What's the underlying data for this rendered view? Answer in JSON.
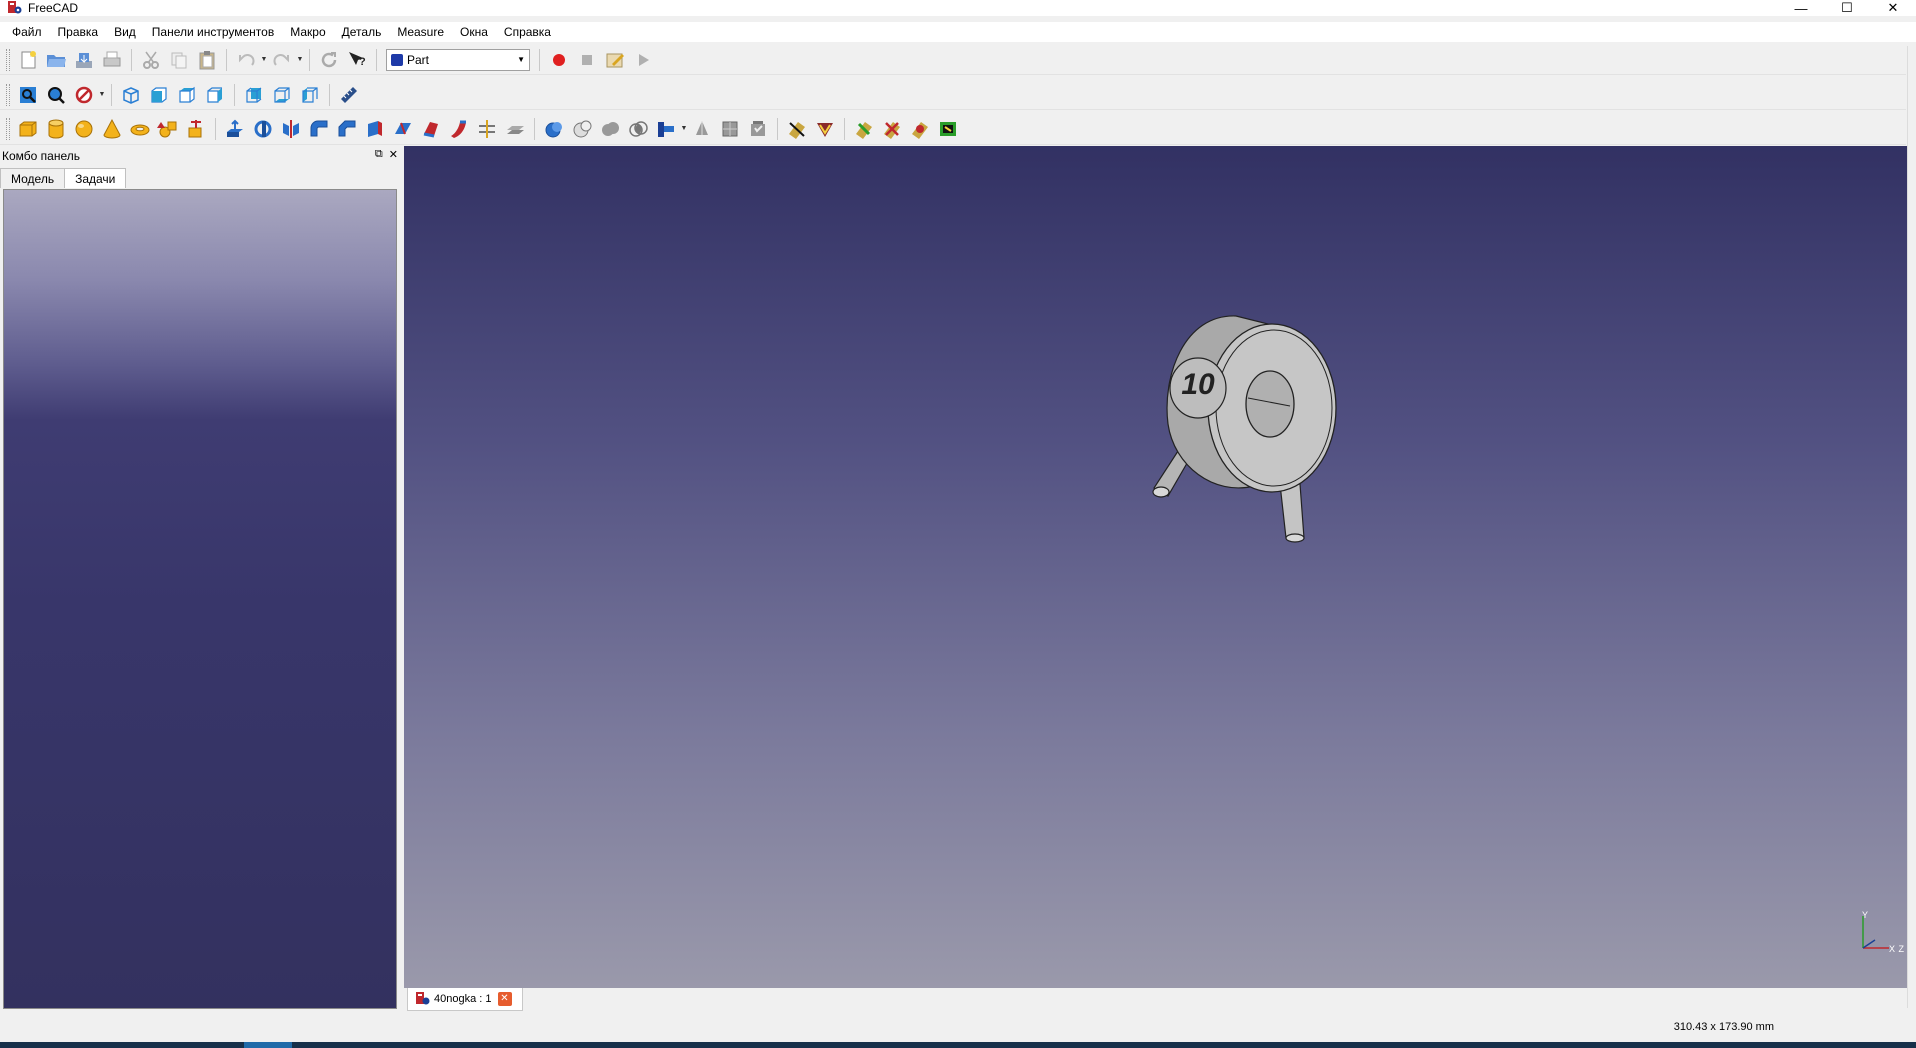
{
  "window": {
    "title": "FreeCAD",
    "controls": [
      "—",
      "☐",
      "✕"
    ]
  },
  "menu": [
    "Файл",
    "Правка",
    "Вид",
    "Панели инструментов",
    "Макро",
    "Деталь",
    "Measure",
    "Окна",
    "Справка"
  ],
  "toolbar": {
    "workbench_value": "Part"
  },
  "combo": {
    "title": "Комбо панель",
    "tabs": [
      "Модель",
      "Задачи"
    ],
    "active_tab": "Задачи"
  },
  "model": {
    "engraving": "10"
  },
  "axis": {
    "y": "Y",
    "x": "X",
    "z": "Z"
  },
  "document_tab": {
    "label": "40nogka : 1"
  },
  "status": {
    "dimensions": "310.43 x 173.90 mm"
  },
  "colors": {
    "view_top": "#323163",
    "view_bottom": "#9a99ab",
    "accent_record": "#e02020",
    "close_tab": "#e65c2e"
  },
  "icons": {
    "toolbar1": [
      "new-file-icon",
      "open-icon",
      "save-icon",
      "print-icon",
      "cut-icon",
      "copy-icon",
      "paste-icon",
      "undo-icon",
      "redo-icon",
      "refresh-icon",
      "whats-this-icon",
      "workbench-selector",
      "macro-record-icon",
      "macro-stop-icon",
      "macro-edit-icon",
      "macro-run-icon"
    ],
    "toolbar2": [
      "fit-all-icon",
      "fit-selection-icon",
      "draw-style-icon",
      "view-isometric-icon",
      "view-front-icon",
      "view-top-icon",
      "view-right-icon",
      "view-rear-icon",
      "view-bottom-icon",
      "view-left-icon",
      "measure-icon"
    ],
    "toolbar3": [
      "box-icon",
      "cylinder-icon",
      "sphere-icon",
      "cone-icon",
      "torus-icon",
      "primitives-icon",
      "shape-builder-icon",
      "extrude-icon",
      "revolve-icon",
      "mirror-icon",
      "fillet-icon",
      "chamfer-icon",
      "make-face-icon",
      "ruled-surface-icon",
      "loft-icon",
      "sweep-icon",
      "section-icon",
      "cross-sections-icon",
      "boolean-icon",
      "cut-icon",
      "fuse-icon",
      "common-icon",
      "join-features-icon",
      "split-features-icon",
      "compound-tools-icon",
      "check-geometry-icon",
      "defeaturing-icon",
      "measure-linear-icon",
      "measure-angular-icon",
      "measure-refresh-icon",
      "measure-clear-icon",
      "measure-toggle-icon",
      "measure-3d-icon"
    ]
  }
}
